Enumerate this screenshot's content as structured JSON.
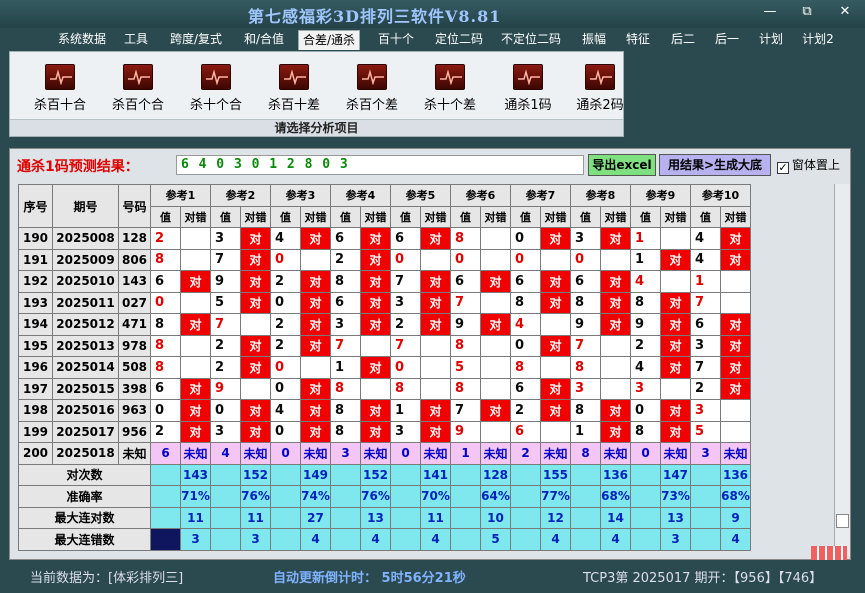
{
  "window": {
    "title": "第七感福彩3D排列三软件V8.81",
    "min": "—",
    "max": "⧉",
    "close": "✕"
  },
  "menu": [
    "系统数据",
    "工具",
    "跨度/复式",
    "和/合值",
    "合差/通杀",
    "百十个",
    "定位二码",
    "不定位二码",
    "振幅",
    "特征",
    "后二",
    "后一",
    "计划",
    "计划2"
  ],
  "menu_active": 4,
  "ribbon": {
    "buttons": [
      "杀百十合",
      "杀百个合",
      "杀十个合",
      "杀百十差",
      "杀百个差",
      "杀十个差",
      "通杀1码",
      "通杀2码"
    ],
    "caption": "请选择分析项目",
    "icon_name": "chart-pulse-icon"
  },
  "prediction": {
    "label": "通杀1码预测结果：",
    "value": "6 4 0 3 0 1 2 8 0 3",
    "excel": "导出excel",
    "generate": "用结果>生成大底",
    "checkbox": "窗体置上",
    "checked": "✓"
  },
  "table": {
    "head": {
      "seq": "序号",
      "period": "期号",
      "num": "号码",
      "refs": [
        "参考1",
        "参考2",
        "参考3",
        "参考4",
        "参考5",
        "参考6",
        "参考7",
        "参考8",
        "参考9",
        "参考10"
      ],
      "val": "值",
      "hit": "对错"
    },
    "rows": [
      {
        "seq": "190",
        "period": "2025008",
        "num": "128",
        "cells": [
          [
            "2",
            "w"
          ],
          [
            "3",
            "r"
          ],
          [
            "4",
            "r"
          ],
          [
            "6",
            "r"
          ],
          [
            "6",
            "r"
          ],
          [
            "8",
            "w"
          ],
          [
            "0",
            "r"
          ],
          [
            "3",
            "r"
          ],
          [
            "1",
            "w"
          ],
          [
            "4",
            "r"
          ]
        ]
      },
      {
        "seq": "191",
        "period": "2025009",
        "num": "806",
        "cells": [
          [
            "8",
            "w"
          ],
          [
            "7",
            "r"
          ],
          [
            "0",
            "w"
          ],
          [
            "2",
            "r"
          ],
          [
            "0",
            "w"
          ],
          [
            "0",
            "w"
          ],
          [
            "0",
            "w"
          ],
          [
            "0",
            "w"
          ],
          [
            "1",
            "r"
          ],
          [
            "4",
            "r"
          ]
        ]
      },
      {
        "seq": "192",
        "period": "2025010",
        "num": "143",
        "cells": [
          [
            "6",
            "r"
          ],
          [
            "9",
            "r"
          ],
          [
            "2",
            "r"
          ],
          [
            "8",
            "r"
          ],
          [
            "7",
            "r"
          ],
          [
            "6",
            "r"
          ],
          [
            "6",
            "r"
          ],
          [
            "6",
            "r"
          ],
          [
            "4",
            "w"
          ],
          [
            "1",
            "w"
          ]
        ]
      },
      {
        "seq": "193",
        "period": "2025011",
        "num": "027",
        "cells": [
          [
            "0",
            "w"
          ],
          [
            "5",
            "r"
          ],
          [
            "0",
            "r"
          ],
          [
            "6",
            "r"
          ],
          [
            "3",
            "r"
          ],
          [
            "7",
            "w"
          ],
          [
            "8",
            "r"
          ],
          [
            "8",
            "r"
          ],
          [
            "8",
            "r"
          ],
          [
            "7",
            "w"
          ]
        ]
      },
      {
        "seq": "194",
        "period": "2025012",
        "num": "471",
        "cells": [
          [
            "8",
            "r"
          ],
          [
            "7",
            "w"
          ],
          [
            "2",
            "r"
          ],
          [
            "3",
            "r"
          ],
          [
            "2",
            "r"
          ],
          [
            "9",
            "r"
          ],
          [
            "4",
            "w"
          ],
          [
            "9",
            "r"
          ],
          [
            "9",
            "r"
          ],
          [
            "6",
            "r"
          ]
        ]
      },
      {
        "seq": "195",
        "period": "2025013",
        "num": "978",
        "cells": [
          [
            "8",
            "w"
          ],
          [
            "2",
            "r"
          ],
          [
            "2",
            "r"
          ],
          [
            "7",
            "w"
          ],
          [
            "7",
            "w"
          ],
          [
            "8",
            "w"
          ],
          [
            "0",
            "r"
          ],
          [
            "7",
            "w"
          ],
          [
            "2",
            "r"
          ],
          [
            "3",
            "r"
          ]
        ]
      },
      {
        "seq": "196",
        "period": "2025014",
        "num": "508",
        "cells": [
          [
            "8",
            "w"
          ],
          [
            "2",
            "r"
          ],
          [
            "0",
            "w"
          ],
          [
            "1",
            "r"
          ],
          [
            "0",
            "w"
          ],
          [
            "5",
            "w"
          ],
          [
            "8",
            "w"
          ],
          [
            "8",
            "w"
          ],
          [
            "4",
            "r"
          ],
          [
            "7",
            "r"
          ]
        ]
      },
      {
        "seq": "197",
        "period": "2025015",
        "num": "398",
        "cells": [
          [
            "6",
            "r"
          ],
          [
            "9",
            "w"
          ],
          [
            "0",
            "r"
          ],
          [
            "8",
            "w"
          ],
          [
            "8",
            "w"
          ],
          [
            "8",
            "w"
          ],
          [
            "6",
            "r"
          ],
          [
            "3",
            "w"
          ],
          [
            "3",
            "w"
          ],
          [
            "2",
            "r"
          ]
        ]
      },
      {
        "seq": "198",
        "period": "2025016",
        "num": "963",
        "cells": [
          [
            "0",
            "r"
          ],
          [
            "0",
            "r"
          ],
          [
            "4",
            "r"
          ],
          [
            "8",
            "r"
          ],
          [
            "1",
            "r"
          ],
          [
            "7",
            "r"
          ],
          [
            "2",
            "r"
          ],
          [
            "8",
            "r"
          ],
          [
            "0",
            "r"
          ],
          [
            "3",
            "w"
          ]
        ]
      },
      {
        "seq": "199",
        "period": "2025017",
        "num": "956",
        "cells": [
          [
            "2",
            "r"
          ],
          [
            "3",
            "r"
          ],
          [
            "0",
            "r"
          ],
          [
            "8",
            "r"
          ],
          [
            "3",
            "r"
          ],
          [
            "9",
            "w"
          ],
          [
            "6",
            "w"
          ],
          [
            "1",
            "r"
          ],
          [
            "8",
            "r"
          ],
          [
            "5",
            "w"
          ]
        ]
      }
    ],
    "pending": {
      "seq": "200",
      "period": "2025018",
      "num": "未知",
      "vals": [
        "6",
        "4",
        "0",
        "3",
        "0",
        "1",
        "2",
        "8",
        "0",
        "3"
      ],
      "unknown": "未知"
    },
    "stats": [
      {
        "label": "对次数",
        "vals": [
          "143",
          "152",
          "149",
          "152",
          "141",
          "128",
          "155",
          "136",
          "147",
          "136"
        ]
      },
      {
        "label": "准确率",
        "vals": [
          "71%",
          "76%",
          "74%",
          "76%",
          "70%",
          "64%",
          "77%",
          "68%",
          "73%",
          "68%"
        ]
      },
      {
        "label": "最大连对数",
        "vals": [
          "11",
          "11",
          "27",
          "13",
          "11",
          "10",
          "12",
          "14",
          "13",
          "9"
        ]
      },
      {
        "label": "最大连错数",
        "vals": [
          "3",
          "3",
          "4",
          "4",
          "4",
          "5",
          "4",
          "4",
          "3",
          "4"
        ]
      }
    ],
    "hit_mark": "对"
  },
  "status": {
    "current": "当前数据为：[体彩排列三]",
    "countdown": "自动更新倒计时： 5时56分21秒",
    "issue": "TCP3第 2025017 期开：【956】【746】"
  },
  "colors": {
    "hit": "#f00000",
    "unknown": "#f3c6f5",
    "stats": "#7fe8ef",
    "prediction": "#0a8a0a"
  }
}
